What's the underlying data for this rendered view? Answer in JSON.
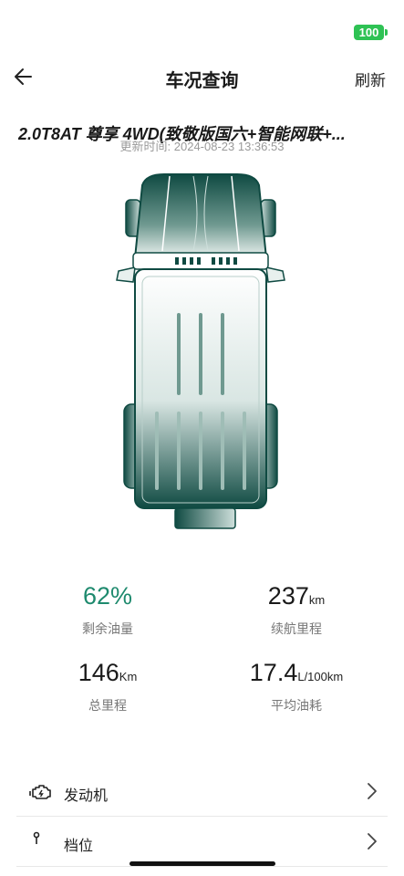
{
  "status_bar": {
    "battery": "100",
    "battery_color": "#2ec254"
  },
  "nav": {
    "title": "车况查询",
    "refresh_label": "刷新",
    "back_icon": "arrow-left-icon"
  },
  "vehicle": {
    "model": "2.0T8AT 尊享 4WD(致敬版国六+智能网联+...",
    "update_time": "更新时间: 2024-08-23 13:36:53"
  },
  "stats": [
    {
      "value": "62%",
      "unit": "",
      "label": "剩余油量",
      "color": "#1e8a6e"
    },
    {
      "value": "237",
      "unit": "km",
      "label": "续航里程"
    },
    {
      "value": "146",
      "unit": "Km",
      "label": "总里程"
    },
    {
      "value": "17.4",
      "unit": "L/100km",
      "label": "平均油耗"
    }
  ],
  "list": [
    {
      "label": "发动机",
      "icon": "engine-icon"
    },
    {
      "label": "档位",
      "icon": "gear-position-icon"
    }
  ],
  "colors": {
    "accent": "#1e8a6e",
    "car_dark": "#0f4a42"
  }
}
